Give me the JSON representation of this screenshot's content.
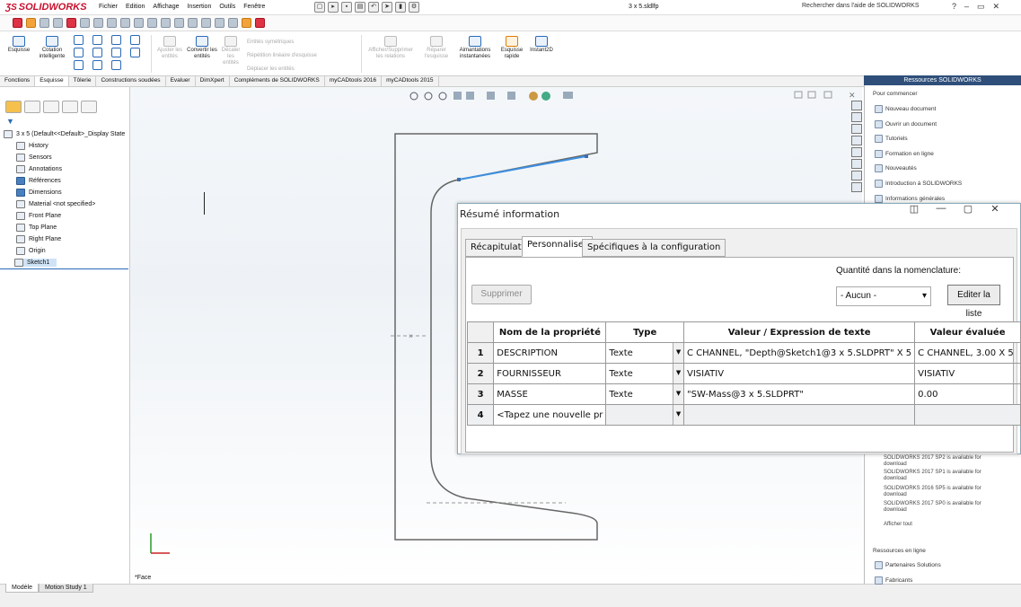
{
  "app": {
    "logo": "SOLIDWORKS",
    "document_title": "3 x 5.sldlfp",
    "search_help": "Rechercher dans l'aide de SOLIDWORKS",
    "menus": [
      "Fichier",
      "Edition",
      "Affichage",
      "Insertion",
      "Outils",
      "Fenêtre"
    ]
  },
  "ribbon": {
    "buttons": [
      "Esquisse",
      "Cotation intelligente",
      "Ajuster les entités",
      "Convertir les entités",
      "Décaler les entités",
      "Entités symétriques",
      "Répétition linéaire d'esquisse",
      "Déplacer les entités",
      "Afficher/Supprimer les relations",
      "Réparer l'esquisse",
      "Aimantations instantanées",
      "Esquisse rapide",
      "Instant2D"
    ]
  },
  "command_tabs": [
    "Fonctions",
    "Esquisse",
    "Tôlerie",
    "Constructions soudées",
    "Evaluer",
    "DimXpert",
    "Compléments de SOLIDWORKS",
    "myCADtools 2016",
    "myCADtools 2015"
  ],
  "command_tabs_active": "Esquisse",
  "feature_tree": {
    "root": "3 x 5  (Default<<Default>_Display State",
    "items": [
      "History",
      "Sensors",
      "Annotations",
      "Références",
      "Dimensions",
      "Material <not specified>",
      "Front Plane",
      "Top Plane",
      "Right Plane",
      "Origin",
      "Sketch1"
    ],
    "selected": "Sketch1"
  },
  "viewport": {
    "view_label": "*Face"
  },
  "bottom_tabs": [
    "Modèle",
    "Motion Study 1"
  ],
  "taskpane": {
    "title": "Ressources SOLIDWORKS",
    "section1": "Pour commencer",
    "items": [
      "Nouveau document",
      "Ouvrir un document",
      "Tutoriels",
      "Formation en ligne",
      "Nouveautés",
      "Introduction à SOLIDWORKS",
      "Informations générales"
    ],
    "news": [
      "SOLIDWORKS 2017 SP2 is available for download",
      "SOLIDWORKS 2017 SP1 is available for download",
      "SOLIDWORKS 2016 SP5 is available for download",
      "SOLIDWORKS 2017 SP0 is available for download"
    ],
    "show_all": "Afficher tout",
    "section2": "Ressources en ligne",
    "online": [
      "Partenaires Solutions",
      "Fabricants"
    ]
  },
  "dialog": {
    "title": "Résumé information",
    "tabs": [
      "Récapitulatif",
      "Personnaliser",
      "Spécifiques à la configuration"
    ],
    "active_tab": "Personnaliser",
    "delete_button": "Supprimer",
    "qty_label": "Quantité dans la nomenclature:",
    "qty_value": "- Aucun -",
    "edit_list_button": "Editer la liste",
    "columns": [
      "Nom de la propriété",
      "Type",
      "Valeur / Expression de texte",
      "Valeur évaluée"
    ],
    "rows": [
      {
        "n": "1",
        "name": "DESCRIPTION",
        "type": "Texte",
        "expr": " C CHANNEL, \"Depth@Sketch1@3 x 5.SLDPRT\" X 5",
        "eval": " C CHANNEL, 3.00 X 5"
      },
      {
        "n": "2",
        "name": "FOURNISSEUR",
        "type": "Texte",
        "expr": "VISIATIV",
        "eval": "VISIATIV"
      },
      {
        "n": "3",
        "name": "MASSE",
        "type": "Texte",
        "expr": "\"SW-Mass@3 x 5.SLDPRT\"",
        "eval": "0.00"
      },
      {
        "n": "4",
        "name": "<Tapez une nouvelle pr",
        "type": "",
        "expr": "",
        "eval": ""
      }
    ]
  }
}
